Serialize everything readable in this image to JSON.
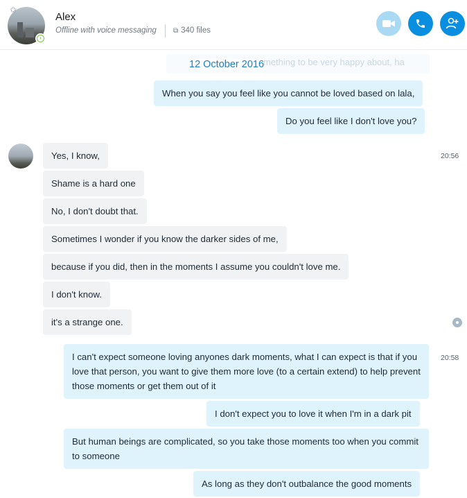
{
  "contact": {
    "name": "Alex",
    "status": "Offline with voice messaging",
    "files": "340 files"
  },
  "icons": {
    "favorite": "star-icon",
    "presence": "forwarding-presence-icon",
    "files": "files-icon",
    "video": "video-call-icon",
    "call": "phone-icon",
    "add": "add-people-icon"
  },
  "colors": {
    "accent": "#0a8fe0",
    "accent_disabled": "#aad9f4",
    "outgoing_bubble": "#dff3fd",
    "incoming_bubble": "#f1f2f4",
    "date": "#1b7fc4"
  },
  "conversation": {
    "date_separator": "12 October 2016",
    "ghost_text": "mething to be very happy about, ha",
    "messages": [
      {
        "dir": "out",
        "text": "When you say you feel like you cannot be loved based on lala,"
      },
      {
        "dir": "out",
        "text": "Do you feel like I don't love you?"
      },
      {
        "dir": "in",
        "text": "Yes, I know,"
      },
      {
        "dir": "in",
        "text": "Shame is a hard one"
      },
      {
        "dir": "in",
        "text": "No, I don't doubt that."
      },
      {
        "dir": "in",
        "text": "Sometimes I wonder if you know the darker sides of me,"
      },
      {
        "dir": "in",
        "text": "because if you did, then in the moments I assume you couldn't love me."
      },
      {
        "dir": "in",
        "text": "I don't know."
      },
      {
        "dir": "in",
        "text": "it's a strange one."
      },
      {
        "dir": "out",
        "text": "I can't expect someone loving anyones dark moments, what I can expect is that if you love that person, you want to give them more love (to a certain extend) to help prevent those moments or get them out of it"
      },
      {
        "dir": "out",
        "text": "I don't expect you to love it when I'm in a dark pit"
      },
      {
        "dir": "out",
        "text": "But human beings are complicated, so you take those moments too when you commit to someone"
      },
      {
        "dir": "out",
        "text": "As long as they don't outbalance the good moments"
      }
    ],
    "timestamps": [
      "20:56",
      "20:58"
    ]
  }
}
